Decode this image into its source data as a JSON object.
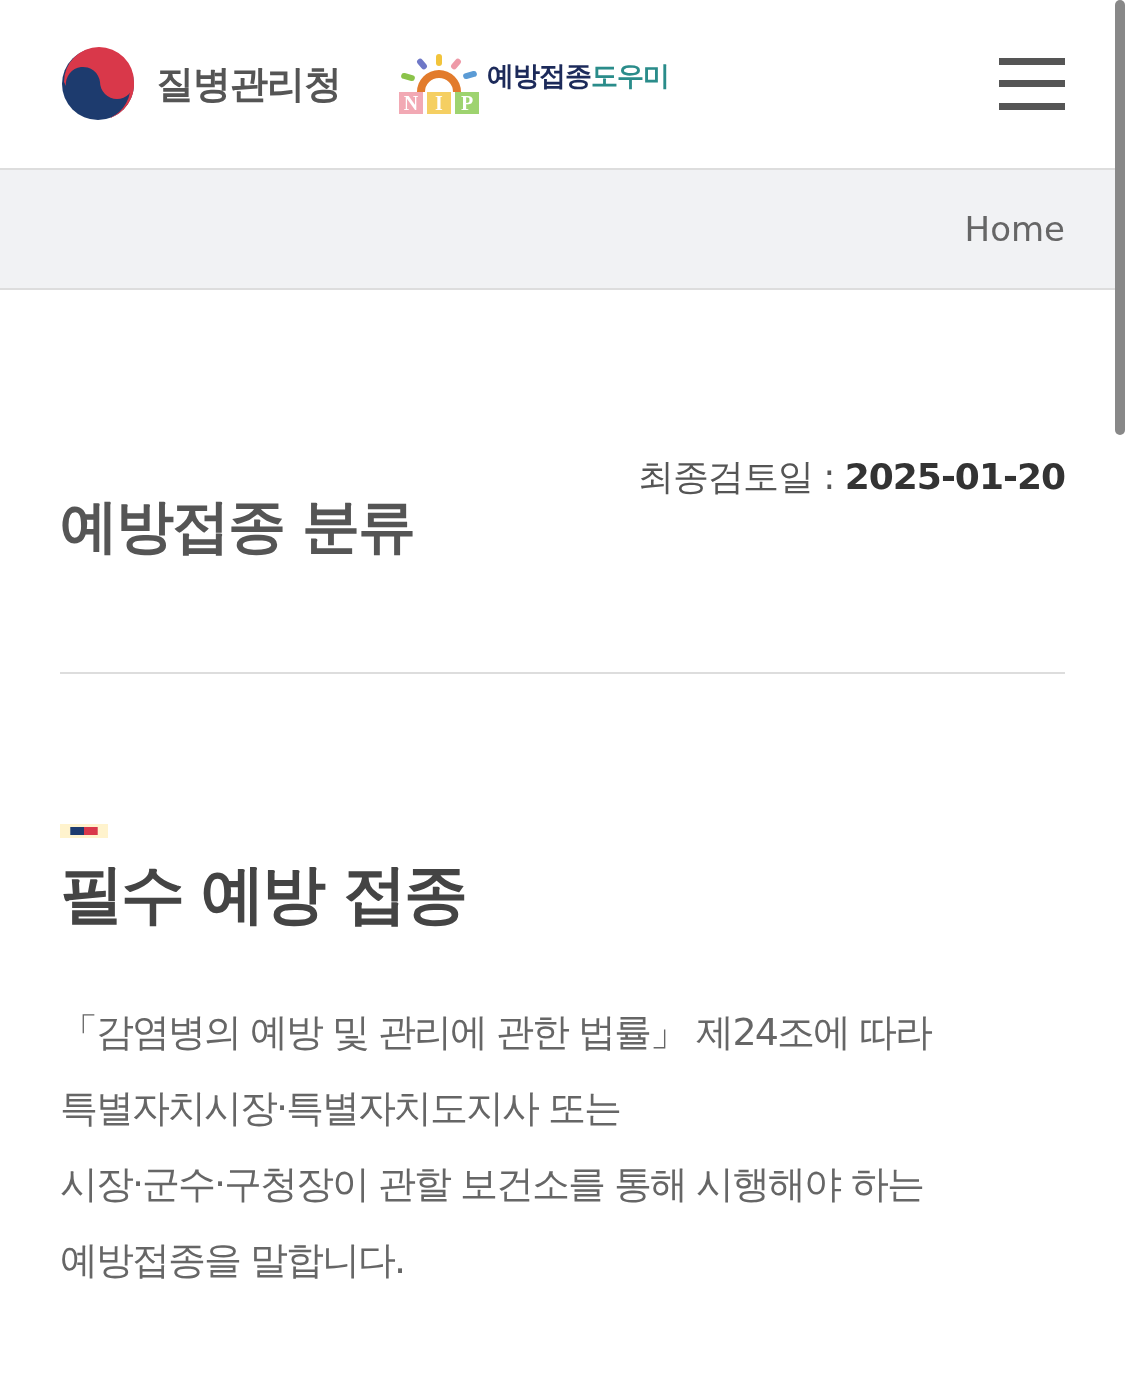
{
  "header": {
    "agency_name": "질병관리청",
    "nip_letters": [
      "N",
      "I",
      "P"
    ],
    "service_name": [
      {
        "text": "예방접종",
        "kind": "primary"
      },
      {
        "text": "도우미",
        "kind": "accent"
      }
    ]
  },
  "breadcrumb": {
    "items": [
      "Home"
    ]
  },
  "page": {
    "title": "예방접종 분류",
    "review_label": "최종검토일 :",
    "review_date": "2025-01-20"
  },
  "section": {
    "heading": "필수 예방 접종",
    "paragraph_lines": [
      "「감염병의 예방 및 관리에 관한 법률」 제24조에 따라",
      "특별자치시장·특별자치도지사 또는",
      "시장·군수·구청장이 관할 보건소를 통해 시행해야 하는",
      "예방접종을 말합니다."
    ]
  }
}
